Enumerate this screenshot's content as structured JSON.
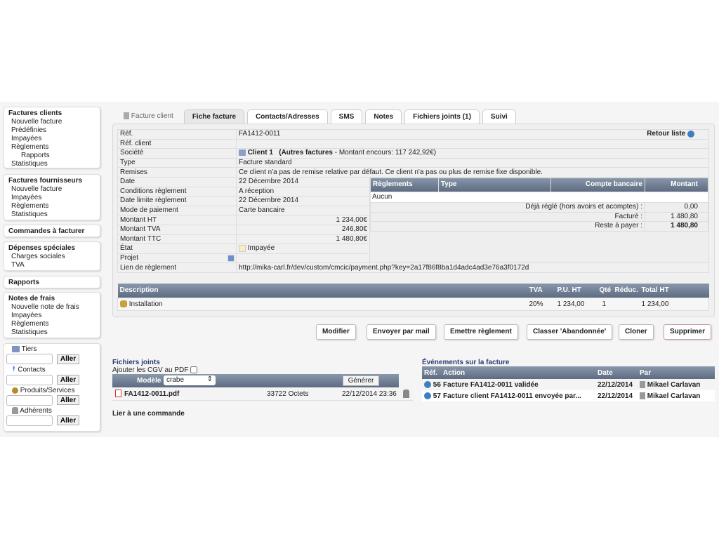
{
  "sidebar": {
    "factures_clients": {
      "title": "Factures clients",
      "items": [
        "Nouvelle facture",
        "Prédéfinies",
        "Impayées",
        "Règlements"
      ],
      "sub": "Rapports",
      "last": "Statistiques"
    },
    "factures_fournisseurs": {
      "title": "Factures fournisseurs",
      "items": [
        "Nouvelle facture",
        "Impayées",
        "Règlements",
        "Statistiques"
      ]
    },
    "commandes": {
      "title": "Commandes à facturer"
    },
    "depenses": {
      "title": "Dépenses spéciales",
      "items": [
        "Charges sociales",
        "TVA"
      ]
    },
    "rapports": {
      "title": "Rapports"
    },
    "notes": {
      "title": "Notes de frais",
      "items": [
        "Nouvelle note de frais",
        "Impayées",
        "Règlements",
        "Statistiques"
      ]
    },
    "search": {
      "tiers": "Tiers",
      "contacts": "Contacts",
      "produits": "Produits/Services",
      "adherents": "Adhérents",
      "go": "Aller"
    }
  },
  "tabs": {
    "head": "Facture client",
    "items": [
      "Fiche facture",
      "Contacts/Adresses",
      "SMS",
      "Notes",
      "Fichiers joints (1)",
      "Suivi"
    ]
  },
  "invoice": {
    "retour": "Retour liste",
    "labels": {
      "ref": "Réf.",
      "ref_client": "Réf. client",
      "societe": "Société",
      "type": "Type",
      "remises": "Remises",
      "date": "Date",
      "conditions": "Conditions règlement",
      "date_limite": "Date limite règlement",
      "mode": "Mode de paiement",
      "ht": "Montant HT",
      "tva": "Montant TVA",
      "ttc": "Montant TTC",
      "etat": "État",
      "projet": "Projet",
      "lien": "Lien de règlement"
    },
    "ref": "FA1412-0011",
    "ref_client": "",
    "client": "Client 1",
    "client_extra_bold": "(Autres factures",
    "client_extra": " - Montant encours: 117 242,92€)",
    "type": "Facture standard",
    "remises": "Ce client n'a pas de remise relative par défaut. Ce client n'a pas ou plus de remise fixe disponible.",
    "date": "22 Décembre 2014",
    "conditions": "A réception",
    "date_limite": "22 Décembre 2014",
    "mode": "Carte bancaire",
    "ht": "1 234,00€",
    "tva": "246,80€",
    "ttc": "1 480,80€",
    "etat": "Impayée",
    "lien": "http://mika-carl.fr/dev/custom/cmcic/payment.php?key=2a17f86f8ba1d4adc4ad3e76a3f0172d"
  },
  "payments": {
    "headers": [
      "Règlements",
      "Type",
      "Compte bancaire",
      "Montant"
    ],
    "none": "Aucun",
    "deja_label": "Déjà réglé (hors avoirs et acomptes) :",
    "deja": "0,00",
    "facture_label": "Facturé :",
    "facture": "1 480,80",
    "reste_label": "Reste à payer :",
    "reste": "1 480,80"
  },
  "lines": {
    "headers": [
      "Description",
      "TVA",
      "P.U. HT",
      "Qté",
      "Réduc.",
      "Total HT"
    ],
    "rows": [
      {
        "desc": "Installation",
        "tva": "20%",
        "pu": "1 234,00",
        "qte": "1",
        "reduc": "",
        "total": "1 234,00"
      }
    ]
  },
  "buttons": {
    "modifier": "Modifier",
    "mail": "Envoyer par mail",
    "reglement": "Emettre règlement",
    "abandon": "Classer 'Abandonnée'",
    "cloner": "Cloner",
    "supprimer": "Supprimer"
  },
  "files": {
    "title": "Fichiers joints",
    "cgv": "Ajouter les CGV au PDF",
    "modele_label": "Modèle",
    "modele": "crabe",
    "generer": "Générer",
    "file": {
      "name": "FA1412-0011.pdf",
      "size": "33722 Octets",
      "date": "22/12/2014 23:36"
    },
    "lier": "Lier à une commande"
  },
  "events": {
    "title": "Événements sur la facture",
    "headers": [
      "Réf.",
      "Action",
      "Date",
      "Par"
    ],
    "rows": [
      {
        "ref": "56",
        "action": "Facture FA1412-0011 validée",
        "date": "22/12/2014",
        "par": "Mikael Carlavan"
      },
      {
        "ref": "57",
        "action": "Facture client FA1412-0011 envoyée par...",
        "date": "22/12/2014",
        "par": "Mikael Carlavan"
      }
    ]
  }
}
